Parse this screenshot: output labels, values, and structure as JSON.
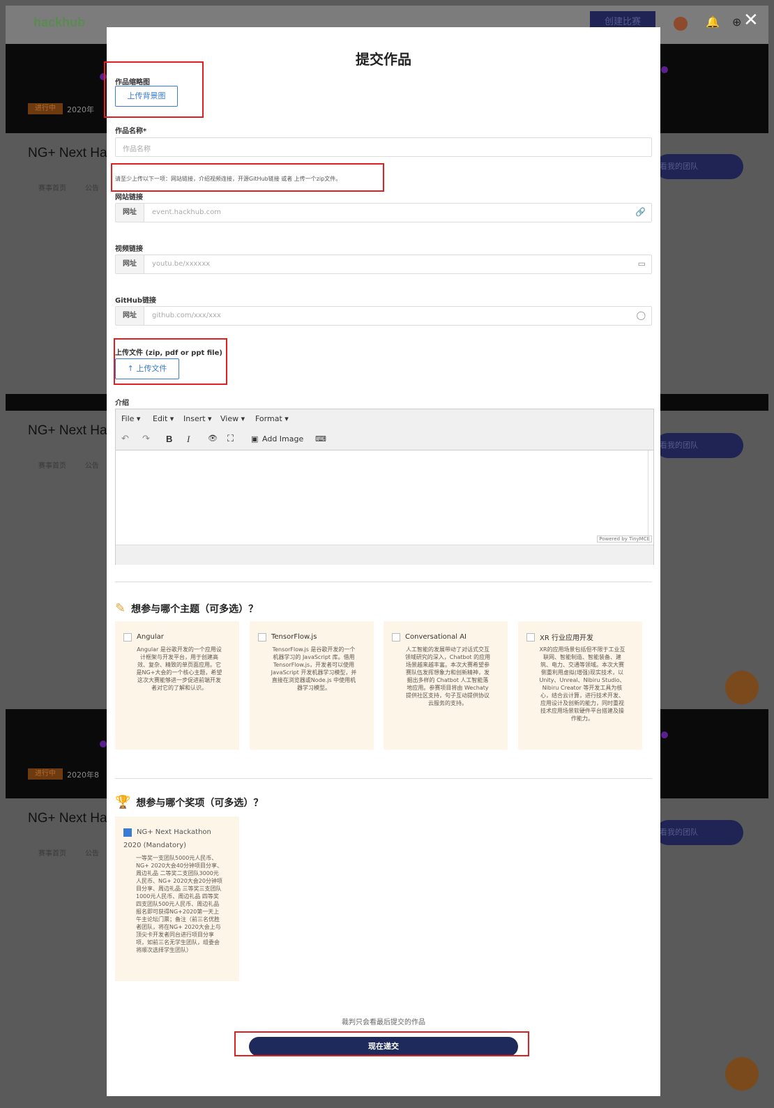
{
  "background": {
    "logo": "hackhub",
    "create_button": "创建比赛",
    "banner_status": "进行中",
    "banner_dates": [
      "2020年",
      "2020年8"
    ],
    "hackathon_title": "NG+ Next Ha",
    "sub_links": [
      "赛事首页",
      "公告"
    ],
    "team_button": "看我的团队"
  },
  "modal": {
    "title": "提交作品",
    "close_icon": "close-icon",
    "thumbnail": {
      "label": "作品缩略图",
      "button": "上传背景图"
    },
    "name": {
      "label": "作品名称*",
      "placeholder": "作品名称"
    },
    "hint": "请至少上传以下一项：网站链接，介绍视频连接，开源GitHub链接 或者 上传一个zip文件。",
    "website": {
      "label": "网站链接",
      "addon": "网址",
      "placeholder": "event.hackhub.com",
      "icon": "link-icon"
    },
    "video": {
      "label": "视频链接",
      "addon": "网址",
      "placeholder": "youtu.be/xxxxxx",
      "icon": "video-icon"
    },
    "github": {
      "label": "GitHub链接",
      "addon": "网址",
      "placeholder": "github.com/xxx/xxx",
      "icon": "github-icon"
    },
    "upload": {
      "label": "上传文件 (zip, pdf or ppt file)",
      "button": "上传文件"
    },
    "intro": {
      "label": "介绍",
      "menus": [
        "File ▾",
        "Edit ▾",
        "Insert ▾",
        "View ▾",
        "Format ▾"
      ],
      "tools": {
        "undo": "↶",
        "redo": "↷",
        "bold": "B",
        "italic": "I",
        "preview": "👁",
        "fullscreen": "⛶",
        "image_icon": "▣",
        "add_image": "Add Image",
        "code": "⌨"
      },
      "powered_by": "Powered by TinyMCE"
    },
    "topics": {
      "heading": "想参与哪个主题（可多选）？",
      "items": [
        {
          "title": "Angular",
          "checked": false,
          "desc": "Angular 是谷歌开发的一个应用设计框架与开发平台，用于创建高效、复杂、精致的单页面应用。它是NG+大会的一个核心主题，希望这次大赛能够进一步促进前端开发者对它的了解和认识。"
        },
        {
          "title": "TensorFlow.js",
          "checked": false,
          "desc": "TensorFlow.js 是谷歌开发的一个机器学习的 JavaScript 库。借用TensorFlow.js，开发者可以使用JavaScript 开发机器学习模型，并直接在浏览器或Node.js 中使用机器学习模型。"
        },
        {
          "title": "Conversational AI",
          "checked": false,
          "desc": "人工智能的发展带动了对话式交互领域研究的深入，Chatbot 的应用场景越来越丰富。本次大赛希望参赛队伍发挥想象力和创新精神，发掘出多样的 Chatbot 人工智能落地应用。参赛项目将由 Wechaty 提供社区支持，句子互动提供协议云服务的支持。"
        },
        {
          "title": "XR 行业应用开发",
          "checked": false,
          "desc": "XR的应用场景包括但不限于工业互联网、智能制造、智能装备、建筑、电力、交通等领域。本次大赛侧重利用虚拟(增强)现实技术，以 Unity、Unreal、Nibiru Studio、Nibiru Creator 等开发工具为核心，结合云计算，进行技术开发、应用设计及创新的能力，同时重视技术应用场景软硬件平台搭建及操作能力。"
        }
      ]
    },
    "awards": {
      "heading": "想参与哪个奖项（可多选）？",
      "items": [
        {
          "title": "NG+ Next Hackathon 2020 (Mandatory)",
          "checked": true,
          "desc": "一等奖一支团队5000元人民币、NG+ 2020大会40分钟项目分享、周边礼品 二等奖二支团队3000元人民币、NG+ 2020大会20分钟项目分享、周边礼品 三等奖三支团队1000元人民币、周边礼品 四等奖四支团队500元人民币、周边礼品 报名即可获得NG+2020第一天上午主论坛门票；备注（前三名优胜者团队，将在NG+ 2020大会上与顶尖卡开发者同台进行项目分享项，如前三名无学生团队，组委会将顺次选择学生团队）"
        }
      ]
    },
    "note": "裁判只会看最后提交的作品",
    "submit": "现在递交"
  }
}
